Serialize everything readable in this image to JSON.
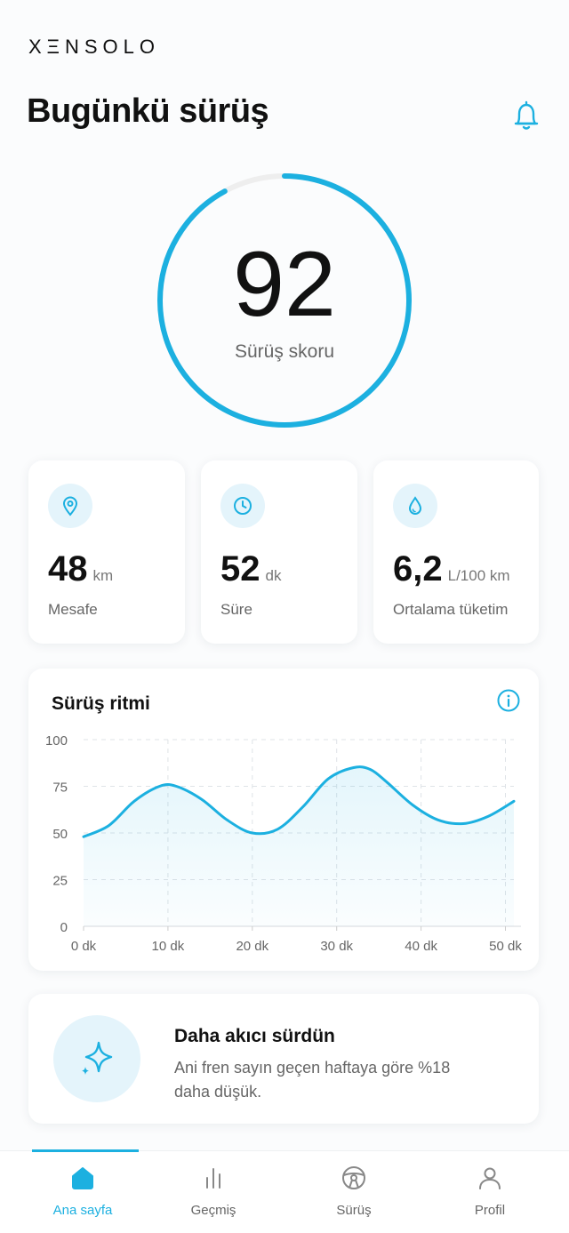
{
  "brand": "XΞNSOLO",
  "header": {
    "title": "Bugünkü sürüş",
    "bell_icon": "bell-icon"
  },
  "score": {
    "value": "92",
    "label": "Sürüş skoru",
    "fraction": 0.92
  },
  "stats": [
    {
      "icon": "location-pin-icon",
      "value": "48",
      "unit": "km",
      "label": "Mesafe"
    },
    {
      "icon": "clock-icon",
      "value": "52",
      "unit": "dk",
      "label": "Süre"
    },
    {
      "icon": "drop-icon",
      "value": "6,2",
      "unit": "L/100 km",
      "label": "Ortalama tüketim"
    }
  ],
  "chart": {
    "title": "Sürüş ritmi",
    "info_icon": "info-icon"
  },
  "chart_data": {
    "type": "area",
    "title": "Sürüş ritmi",
    "xlabel": "",
    "ylabel": "",
    "x_ticks": [
      "0 dk",
      "10 dk",
      "20 dk",
      "30 dk",
      "40 dk",
      "50 dk"
    ],
    "y_ticks": [
      "0",
      "25",
      "50",
      "75",
      "100"
    ],
    "xlim": [
      0,
      51
    ],
    "ylim": [
      0,
      100
    ],
    "grid": true,
    "series": [
      {
        "x": [
          0,
          3,
          6,
          9,
          11,
          14,
          17,
          20,
          23,
          26,
          29,
          32,
          34,
          36,
          39,
          42,
          45,
          48,
          51
        ],
        "values": [
          48,
          54,
          67,
          75,
          75,
          68,
          57,
          50,
          52,
          64,
          79,
          85,
          84,
          77,
          65,
          57,
          55,
          59,
          67
        ]
      }
    ],
    "color": "#1cb0e0"
  },
  "tip": {
    "icon": "sparkle-icon",
    "title": "Daha akıcı sürdün",
    "body": "Ani fren sayın geçen haftaya göre %18 daha düşük."
  },
  "nav": [
    {
      "icon": "home-icon",
      "label": "Ana sayfa",
      "active": true
    },
    {
      "icon": "bar-chart-icon",
      "label": "Geçmiş",
      "active": false
    },
    {
      "icon": "steering-wheel-icon",
      "label": "Sürüş",
      "active": false
    },
    {
      "icon": "user-icon",
      "label": "Profil",
      "active": false
    }
  ],
  "colors": {
    "accent": "#1cb0e0",
    "accent_light": "#e4f4fb",
    "text": "#111111",
    "muted": "#666666"
  }
}
